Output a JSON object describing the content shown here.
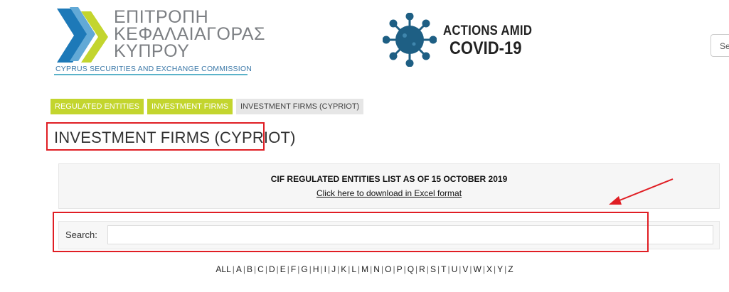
{
  "logo": {
    "greek_text": "ΕΠΙΤΡΟΠΗ\nΚΕΦΑΛΑΙΑΓΟΡΑΣ\nΚΥΠΡΟΥ",
    "english_text": "CYPRUS SECURITIES AND EXCHANGE COMMISSION",
    "colors": {
      "blue": "#1d79b8",
      "green": "#c3d52e",
      "grey": "#7c7f83"
    }
  },
  "covid_banner": {
    "line1": "ACTIONS AMID",
    "line2": "COVID-19",
    "icon": "virus-icon",
    "icon_color": "#1e5f84"
  },
  "header_search": {
    "text": "Se"
  },
  "breadcrumbs": [
    {
      "label": "REGULATED ENTITIES"
    },
    {
      "label": "INVESTMENT FIRMS"
    },
    {
      "label": "INVESTMENT FIRMS (CYPRIOT)"
    }
  ],
  "page_title": "INVESTMENT FIRMS (CYPRIOT)",
  "info": {
    "heading": "CIF REGULATED ENTITIES LIST AS OF 15 OCTOBER 2019",
    "download_link": "Click here to download in Excel format"
  },
  "search": {
    "label": "Search:",
    "value": ""
  },
  "alphabet": [
    "ALL",
    "A",
    "B",
    "C",
    "D",
    "E",
    "F",
    "G",
    "H",
    "I",
    "J",
    "K",
    "L",
    "M",
    "N",
    "O",
    "P",
    "Q",
    "R",
    "S",
    "T",
    "U",
    "V",
    "W",
    "X",
    "Y",
    "Z"
  ],
  "annotation_color": "#e01e24",
  "accent_color": "#c3d52e"
}
